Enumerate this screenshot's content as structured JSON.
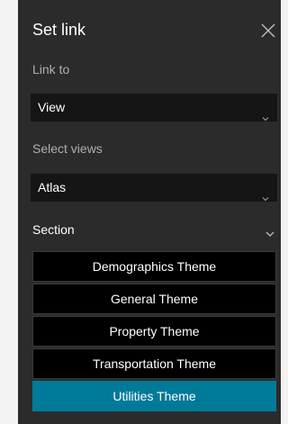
{
  "panel": {
    "title": "Set link",
    "close_icon": "close-icon"
  },
  "link_to": {
    "label": "Link to",
    "value": "View"
  },
  "select_views": {
    "label": "Select views",
    "value": "Atlas"
  },
  "section": {
    "label": "Section",
    "items": [
      {
        "label": "Demographics Theme",
        "selected": false
      },
      {
        "label": "General Theme",
        "selected": false
      },
      {
        "label": "Property Theme",
        "selected": false
      },
      {
        "label": "Transportation Theme",
        "selected": false
      },
      {
        "label": "Utilities Theme",
        "selected": true
      }
    ]
  },
  "colors": {
    "panel_bg": "#2b2b2b",
    "select_bg": "#151515",
    "item_bg": "#000000",
    "accent": "#007a99",
    "muted_text": "#aeaeae"
  }
}
